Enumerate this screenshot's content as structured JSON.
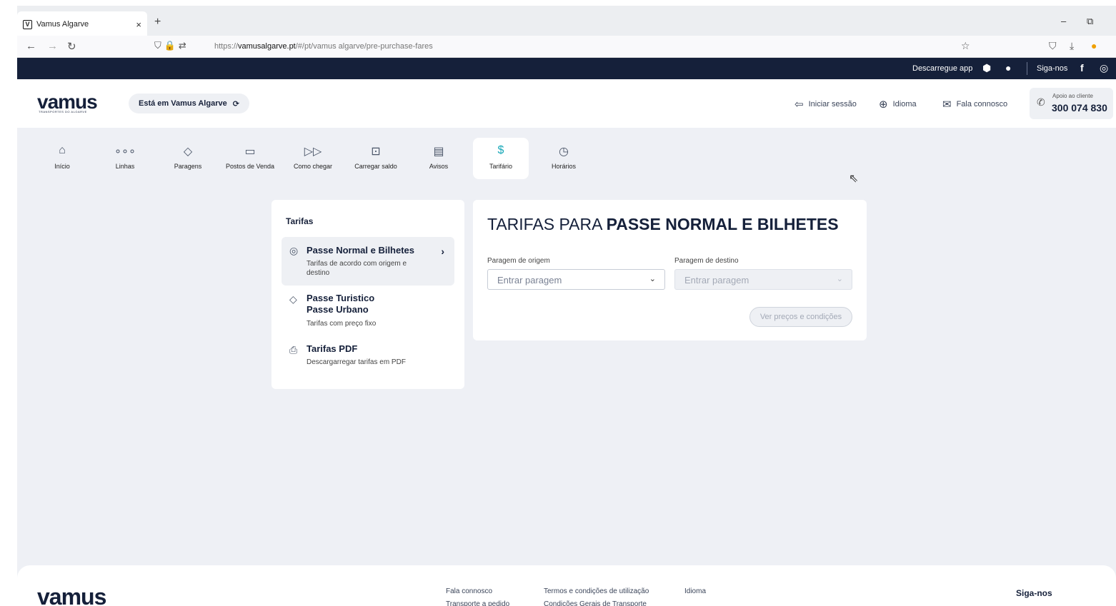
{
  "browser": {
    "tab_title": "Vamus Algarve",
    "tab_favicon": "V",
    "tab_close": "×",
    "new_tab": "+",
    "url_prefix": "https://",
    "url_domain": "vamusalgarve.pt",
    "url_path": "/#/pt/vamus algarve/pre-purchase-fares"
  },
  "topbar": {
    "download_app": "Descarregue app",
    "follow": "Siga-nos"
  },
  "header": {
    "logo": "vamus",
    "logo_sub": "TRANSPORTES DO ALGARVE",
    "region_label": "Está em Vamus Algarve",
    "login": "Iniciar sessão",
    "language": "Idioma",
    "contact": "Fala connosco",
    "support_label": "Apoio ao cliente",
    "support_number": "300 074 830"
  },
  "menu": {
    "items": [
      {
        "label": "Início",
        "icon": "home-icon"
      },
      {
        "label": "Linhas",
        "icon": "lines-icon"
      },
      {
        "label": "Paragens",
        "icon": "stop-icon"
      },
      {
        "label": "Postos de Venda",
        "icon": "card-icon"
      },
      {
        "label": "Como chegar",
        "icon": "directions-icon"
      },
      {
        "label": "Carregar saldo",
        "icon": "topup-icon"
      },
      {
        "label": "Avisos",
        "icon": "news-icon"
      },
      {
        "label": "Tarifário",
        "icon": "fares-icon"
      },
      {
        "label": "Horários",
        "icon": "clock-icon"
      }
    ],
    "active": "Tarifário"
  },
  "sidebar": {
    "title": "Tarifas",
    "items": [
      {
        "title": "Passe Normal e Bilhetes",
        "desc": "Tarifas de acordo com origem e destino"
      },
      {
        "title": "Passe Turistico",
        "title2": "Passe Urbano",
        "desc": "Tarifas com preço fixo"
      },
      {
        "title": "Tarifas PDF",
        "desc": "Descargarregar tarifas em PDF"
      }
    ]
  },
  "fares": {
    "title_light": "TARIFAS PARA ",
    "title_bold": "PASSE NORMAL E BILHETES",
    "origin_label": "Paragem de origem",
    "origin_placeholder": "Entrar paragem",
    "dest_label": "Paragem de destino",
    "dest_placeholder": "Entrar paragem",
    "button": "Ver preços e condições"
  },
  "footer": {
    "logo": "vamus",
    "links": [
      "Fala connosco",
      "Termos e condições de utilização",
      "Idioma",
      "Transporte a pedido",
      "Condições Gerais de Transporte"
    ],
    "follow": "Siga-nos"
  },
  "colors": {
    "navy": "#15203a",
    "accent": "#18a8b8",
    "background": "#eef0f5"
  }
}
